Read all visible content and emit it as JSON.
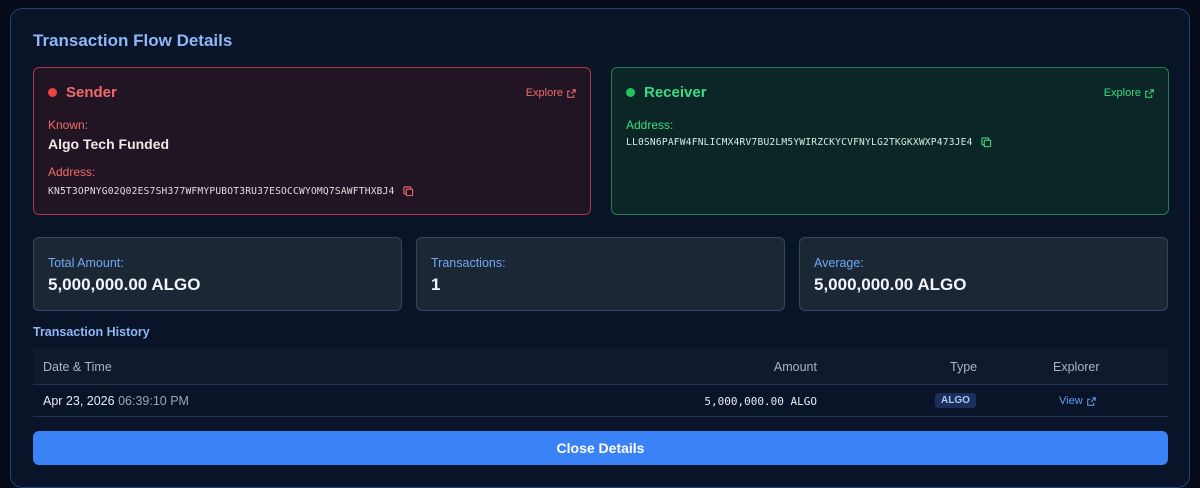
{
  "title": "Transaction Flow Details",
  "sender": {
    "label": "Sender",
    "explore_label": "Explore",
    "known_label": "Known:",
    "known_value": "Algo Tech Funded",
    "address_label": "Address:",
    "address": "KN5T3OPNYG02Q02ES7SH377WFMYPUBOT3RU37ESOCCWYOMQ7SAWFTHXBJ4",
    "color": "#ef4444"
  },
  "receiver": {
    "label": "Receiver",
    "explore_label": "Explore",
    "address_label": "Address:",
    "address": "LL0SN6PAFW4FNLICMX4RV7BU2LM5YWIRZCKYCVFNYLG2TKGKXWXP473JE4",
    "color": "#22c55e"
  },
  "stats": {
    "total_label": "Total Amount:",
    "total_value": "5,000,000.00 ALGO",
    "transactions_label": "Transactions:",
    "transactions_value": "1",
    "average_label": "Average:",
    "average_value": "5,000,000.00 ALGO"
  },
  "history": {
    "title": "Transaction History",
    "columns": {
      "date": "Date & Time",
      "amount": "Amount",
      "type": "Type",
      "explorer": "Explorer"
    },
    "rows": [
      {
        "date": "Apr 23, 2026",
        "time": "06:39:10 PM",
        "amount": "5,000,000.00 ALGO",
        "type": "ALGO",
        "explorer": "View"
      }
    ]
  },
  "close_label": "Close Details",
  "icons": {
    "external": "external-link-icon",
    "copy": "copy-icon"
  },
  "accent": "#3b82f6"
}
